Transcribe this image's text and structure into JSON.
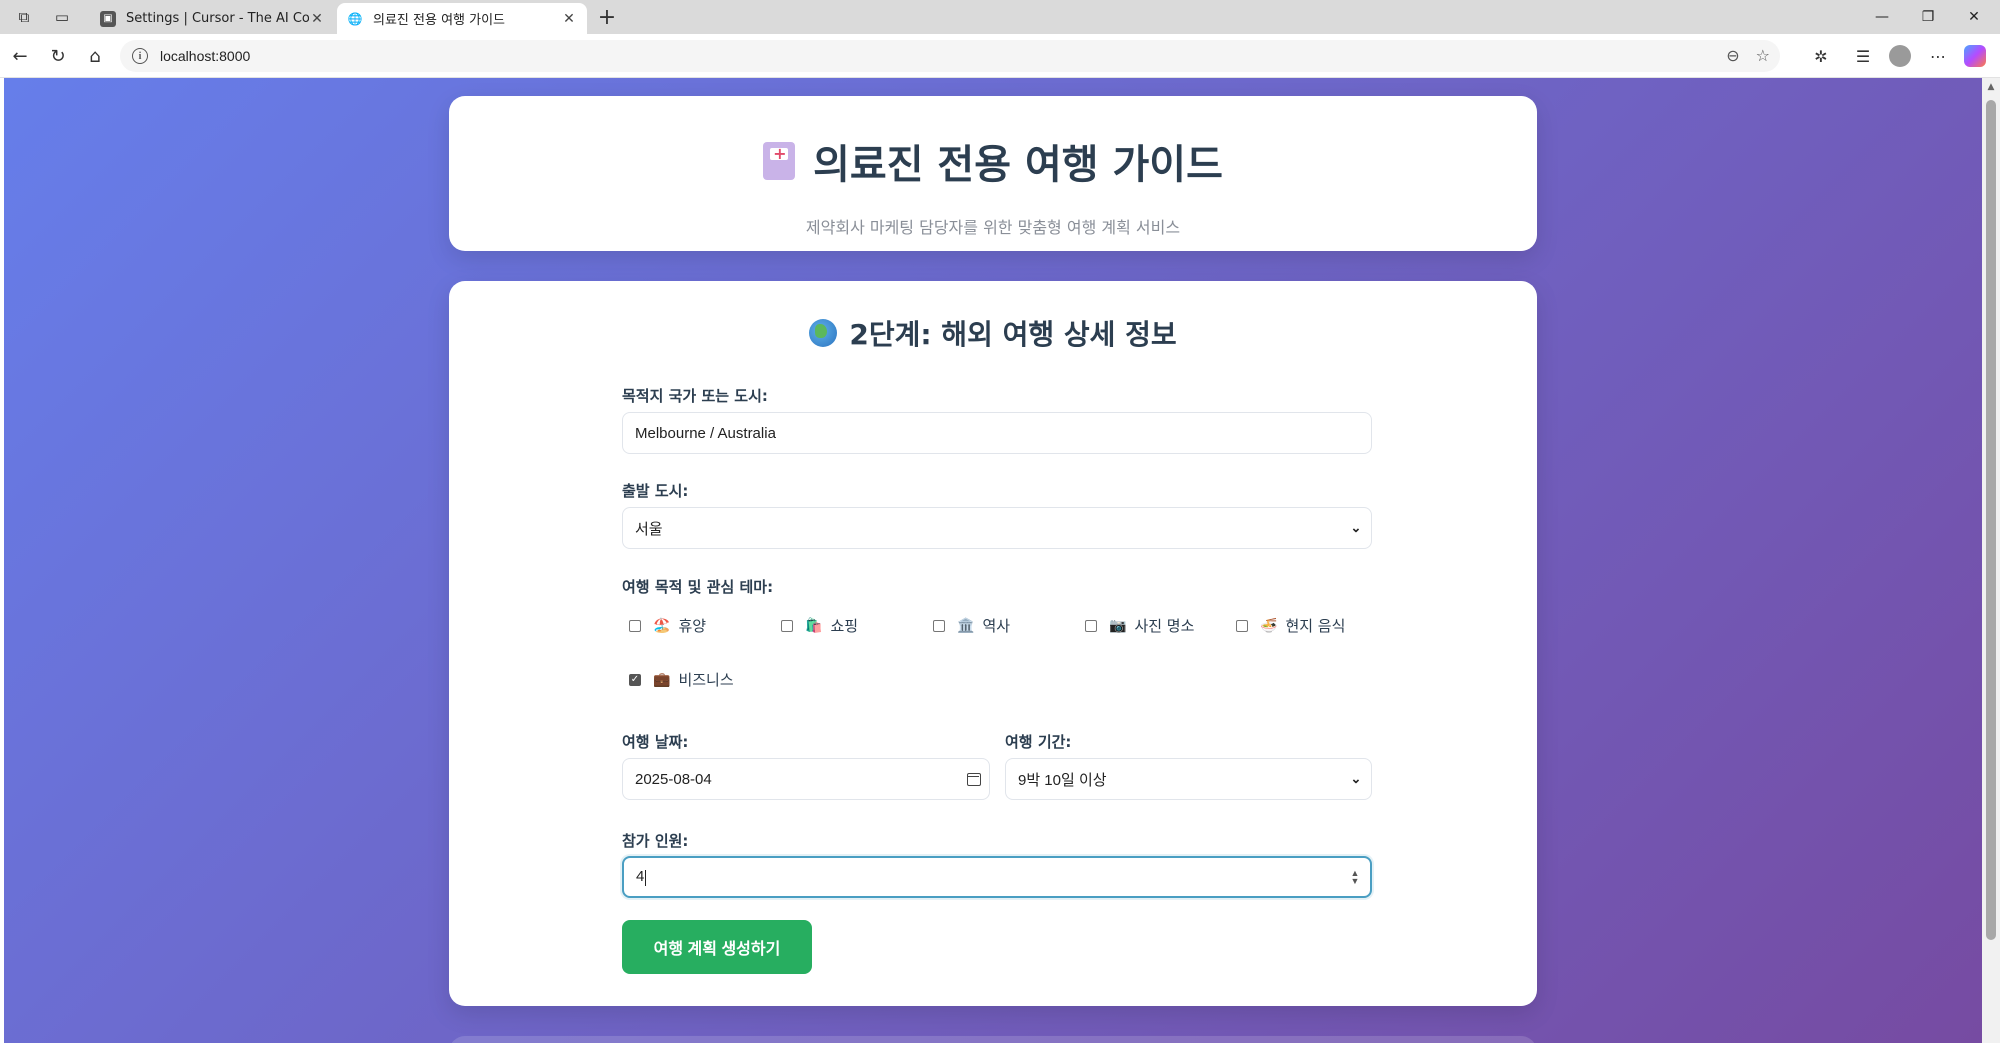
{
  "browser": {
    "tabs": [
      {
        "title": "Settings | Cursor - The AI Code Ed",
        "active": false
      },
      {
        "title": "의료진 전용 여행 가이드",
        "active": true
      }
    ],
    "url": "localhost:8000"
  },
  "header": {
    "title": "의료진 전용 여행 가이드",
    "subtitle": "제약회사 마케팅 담당자를 위한 맞춤형 여행 계획 서비스"
  },
  "form": {
    "step_title": "2단계: 해외 여행 상세 정보",
    "destination": {
      "label": "목적지 국가 또는 도시:",
      "value": "Melbourne / Australia"
    },
    "departure": {
      "label": "출발 도시:",
      "value": "서울"
    },
    "themes": {
      "label": "여행 목적 및 관심 테마:",
      "options": [
        {
          "emoji": "🏖️",
          "label": "휴양",
          "checked": false
        },
        {
          "emoji": "🛍️",
          "label": "쇼핑",
          "checked": false
        },
        {
          "emoji": "🏛️",
          "label": "역사",
          "checked": false
        },
        {
          "emoji": "📷",
          "label": "사진 명소",
          "checked": false
        },
        {
          "emoji": "🍜",
          "label": "현지 음식",
          "checked": false
        },
        {
          "emoji": "💼",
          "label": "비즈니스",
          "checked": true
        }
      ]
    },
    "date": {
      "label": "여행 날짜:",
      "value": "2025-08-04"
    },
    "duration": {
      "label": "여행 기간:",
      "value": "9박 10일 이상"
    },
    "people": {
      "label": "참가 인원:",
      "value": "4"
    },
    "submit_label": "여행 계획 생성하기"
  }
}
